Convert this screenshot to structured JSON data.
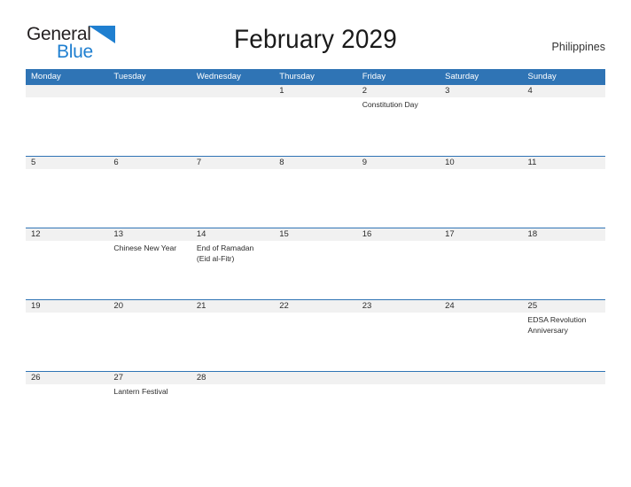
{
  "logo": {
    "word_one": "General",
    "word_two": "Blue",
    "flag_icon": "blue-flag-triangle",
    "accent_dark": "#231f20",
    "accent_blue": "#1f7fd0"
  },
  "header": {
    "title": "February 2029",
    "country": "Philippines"
  },
  "colors": {
    "header_blue": "#2f74b5",
    "row_line_blue": "#2f74b5",
    "date_band_gray": "#f1f1f1",
    "text": "#2b2b2b"
  },
  "calendar": {
    "month": "February",
    "year": "2029",
    "weekday_headers": [
      "Monday",
      "Tuesday",
      "Wednesday",
      "Thursday",
      "Friday",
      "Saturday",
      "Sunday"
    ],
    "weeks": [
      {
        "days": [
          {
            "date": "",
            "events": []
          },
          {
            "date": "",
            "events": []
          },
          {
            "date": "",
            "events": []
          },
          {
            "date": "1",
            "events": []
          },
          {
            "date": "2",
            "events": [
              "Constitution Day"
            ]
          },
          {
            "date": "3",
            "events": []
          },
          {
            "date": "4",
            "events": []
          }
        ]
      },
      {
        "days": [
          {
            "date": "5",
            "events": []
          },
          {
            "date": "6",
            "events": []
          },
          {
            "date": "7",
            "events": []
          },
          {
            "date": "8",
            "events": []
          },
          {
            "date": "9",
            "events": []
          },
          {
            "date": "10",
            "events": []
          },
          {
            "date": "11",
            "events": []
          }
        ]
      },
      {
        "days": [
          {
            "date": "12",
            "events": []
          },
          {
            "date": "13",
            "events": [
              "Chinese New Year"
            ]
          },
          {
            "date": "14",
            "events": [
              "End of Ramadan (Eid al-Fitr)"
            ]
          },
          {
            "date": "15",
            "events": []
          },
          {
            "date": "16",
            "events": []
          },
          {
            "date": "17",
            "events": []
          },
          {
            "date": "18",
            "events": []
          }
        ]
      },
      {
        "days": [
          {
            "date": "19",
            "events": []
          },
          {
            "date": "20",
            "events": []
          },
          {
            "date": "21",
            "events": []
          },
          {
            "date": "22",
            "events": []
          },
          {
            "date": "23",
            "events": []
          },
          {
            "date": "24",
            "events": []
          },
          {
            "date": "25",
            "events": [
              "EDSA Revolution Anniversary"
            ]
          }
        ]
      },
      {
        "days": [
          {
            "date": "26",
            "events": []
          },
          {
            "date": "27",
            "events": [
              "Lantern Festival"
            ]
          },
          {
            "date": "28",
            "events": []
          },
          {
            "date": "",
            "events": []
          },
          {
            "date": "",
            "events": []
          },
          {
            "date": "",
            "events": []
          },
          {
            "date": "",
            "events": []
          }
        ]
      }
    ]
  }
}
